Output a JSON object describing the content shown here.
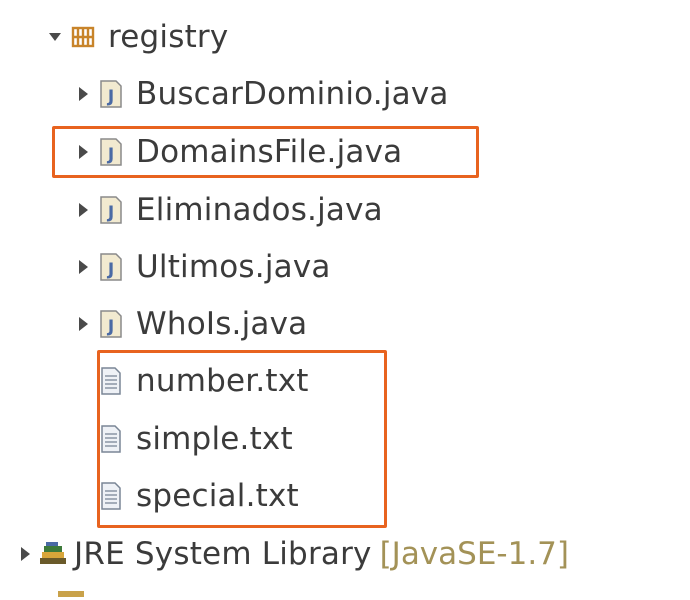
{
  "package_explorer": {
    "package": {
      "label": "registry",
      "icon": "package-icon",
      "expanded": true
    },
    "files": [
      {
        "label": "BuscarDominio.java",
        "icon": "java-file-icon",
        "expandable": true
      },
      {
        "label": "DomainsFile.java",
        "icon": "java-file-icon",
        "expandable": true,
        "highlighted": true
      },
      {
        "label": "Eliminados.java",
        "icon": "java-file-icon",
        "expandable": true
      },
      {
        "label": "Ultimos.java",
        "icon": "java-file-icon",
        "expandable": true
      },
      {
        "label": "WhoIs.java",
        "icon": "java-file-icon",
        "expandable": true
      },
      {
        "label": "number.txt",
        "icon": "text-file-icon",
        "expandable": false,
        "highlighted": true
      },
      {
        "label": "simple.txt",
        "icon": "text-file-icon",
        "expandable": false,
        "highlighted": true
      },
      {
        "label": "special.txt",
        "icon": "text-file-icon",
        "expandable": false,
        "highlighted": true
      }
    ],
    "library": {
      "label": "JRE System Library",
      "decoration": "[JavaSE-1.7]",
      "icon": "library-icon",
      "expandable": true
    }
  },
  "colors": {
    "highlight_border": "#e8631f",
    "decoration_text": "#a39257",
    "package_icon": "#c8842a",
    "java_icon_bg": "#f2ead0",
    "java_icon_letter": "#4a6aa5"
  }
}
